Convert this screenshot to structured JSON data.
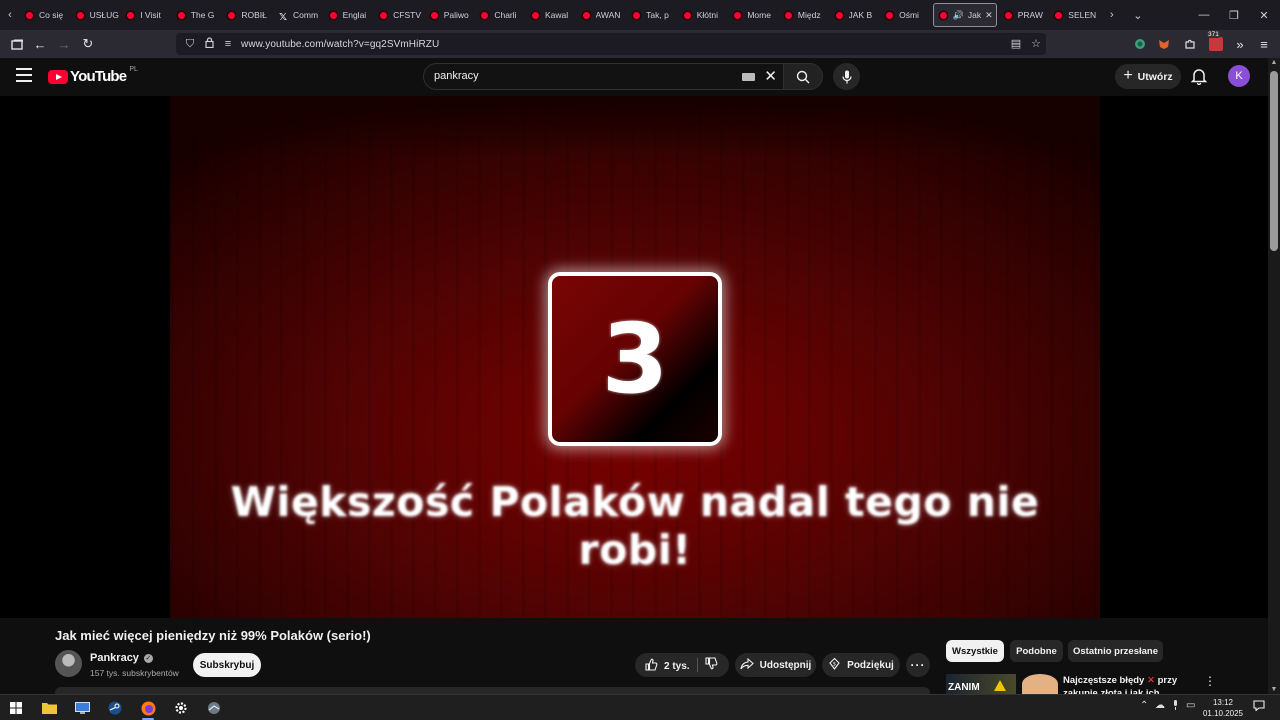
{
  "browser": {
    "tabs": [
      {
        "label": "Co się",
        "icon": "youtube-icon"
      },
      {
        "label": "USŁUG",
        "icon": "youtube-icon"
      },
      {
        "label": "I Visit",
        "icon": "youtube-icon"
      },
      {
        "label": "The G",
        "icon": "youtube-icon"
      },
      {
        "label": "ROBIŁ",
        "icon": "youtube-icon"
      },
      {
        "label": "Comm",
        "icon": "x-icon"
      },
      {
        "label": "Englai",
        "icon": "youtube-icon"
      },
      {
        "label": "CFSTV",
        "icon": "youtube-icon"
      },
      {
        "label": "Paliwo",
        "icon": "youtube-icon"
      },
      {
        "label": "Charli",
        "icon": "youtube-icon"
      },
      {
        "label": "Kawal",
        "icon": "youtube-icon"
      },
      {
        "label": "AWAN",
        "icon": "youtube-icon"
      },
      {
        "label": "Tak, p",
        "icon": "youtube-icon"
      },
      {
        "label": "Kłótni",
        "icon": "youtube-icon"
      },
      {
        "label": "Mome",
        "icon": "youtube-icon"
      },
      {
        "label": "Międz",
        "icon": "youtube-icon"
      },
      {
        "label": "JAK B",
        "icon": "youtube-icon"
      },
      {
        "label": "Ośmi",
        "icon": "youtube-icon"
      },
      {
        "label": "Jak",
        "icon": "youtube-icon",
        "active": true
      },
      {
        "label": "PRAW",
        "icon": "youtube-icon"
      },
      {
        "label": "SELEN",
        "icon": "youtube-icon"
      }
    ],
    "url": "www.youtube.com/watch?v=gq2SVmHiRZU",
    "extension_badge": "371"
  },
  "youtube": {
    "logo_text": "YouTube",
    "country_code": "PL",
    "search_value": "pankracy",
    "create_label": "Utwórz",
    "avatar_letter": "K"
  },
  "video": {
    "overlay_number": "3",
    "overlay_caption": "Większość Polaków nadal tego nie robi!",
    "title": "Jak mieć więcej pieniędzy niż 99% Polaków (serio!)",
    "channel_name": "Pankracy",
    "channel_subs": "157 tys. subskrybentów",
    "subscribe_label": "Subskrybuj",
    "likes": "2 tys.",
    "share_label": "Udostępnij",
    "thanks_label": "Podziękuj"
  },
  "chips": [
    "Wszystkie",
    "Podobne",
    "Ostatnio przesłane"
  ],
  "recommendation": {
    "thumb_text": "ZANIM",
    "title_part1": "Najczęstsze błędy",
    "title_part2": "przy zakupie złota i jak ich uniknąć"
  },
  "taskbar": {
    "time": "13:12",
    "date": "01.10.2025"
  },
  "colors": {
    "youtube_red": "#ff0033",
    "background": "#0f0f0f",
    "avatar": "#8a4fd6"
  }
}
